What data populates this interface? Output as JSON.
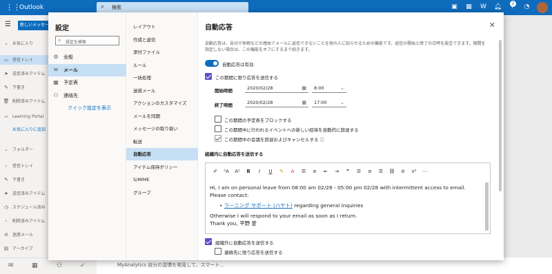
{
  "app": {
    "brand": "Outlook",
    "search_placeholder": "検索",
    "badge_count": "2"
  },
  "leftpane": {
    "new_message": "新しいメッセージ",
    "items": [
      {
        "label": "お気に入り"
      },
      {
        "label": "受信トレイ"
      },
      {
        "label": "送信済みアイテム"
      },
      {
        "label": "下書き"
      },
      {
        "label": "削除済みアイテム"
      },
      {
        "label": "Learning Portal"
      },
      {
        "label": "お気に入りに追加"
      },
      {
        "label": "フォルダー"
      },
      {
        "label": "受信トレイ"
      },
      {
        "label": "下書き"
      },
      {
        "label": "送信済みアイテム"
      },
      {
        "label": "スケジュール済み"
      },
      {
        "label": "削除済みアイテム"
      },
      {
        "label": "迷惑メール"
      },
      {
        "label": "アーカイブ"
      }
    ]
  },
  "maillist": {
    "preview": "MyAnalytics 自分の習慣を発見して、スマート..."
  },
  "settings": {
    "title": "設定",
    "search_placeholder": "設定を検索",
    "categories": [
      {
        "label": "全般",
        "icon": "gear-icon"
      },
      {
        "label": "メール",
        "icon": "mail-icon"
      },
      {
        "label": "予定表",
        "icon": "calendar-icon"
      },
      {
        "label": "連絡先",
        "icon": "people-icon"
      }
    ],
    "quick_settings_link": "クイック設定を表示",
    "mail_sections": [
      "レイアウト",
      "作成と返信",
      "添付ファイル",
      "ルール",
      "一括処理",
      "迷惑メール",
      "アクションのカスタマイズ",
      "メールを同期",
      "メッセージの取り扱い",
      "転送",
      "自動応答",
      "アイテム保持ポリシー",
      "S/MIME",
      "グループ"
    ],
    "selected_section": "自動応答"
  },
  "autoreply": {
    "title": "自動応答",
    "description": "自動応答は、自分が休暇などの理由でメールに返信できないことを他の人に知らせるための機能です。返信の開始と終了の日時を設定できます。期間を指定しない場合は、この機能をオフにするまで続きます。",
    "toggle_label": "自動応答は有効",
    "toggle_on": true,
    "period_checkbox": "この期間に限り応答を送信する",
    "start_label": "開始時間",
    "start_date": "2020/02/28",
    "start_time": "8:00",
    "end_label": "終了時間",
    "end_date": "2020/02/28",
    "end_time": "17:00",
    "opt_block_calendar": "この期間の予定表をブロックする",
    "opt_decline_invites": "この期間中に行われるイベントへの新しい招待を自動的に辞退する",
    "opt_cancel_meetings": "この期間中の会議を辞退およびキャンセルする",
    "internal_heading": "組織内に自動応答を送信する",
    "message_line1": "Hi, I am on personal leave from 08:00 am 02/28 - 05:00 pm 02/28 with intermittent access to email. Please contact:",
    "message_link": "ラーニング サポート (ハヤト)",
    "message_link_suffix": " regarding general inquiries",
    "message_line2": "Otherwise I will respond to your email as soon as I return.",
    "message_line3": "Thank you, 平野 愛",
    "external_checkbox": "組織外に自動応答を送信する",
    "contacts_only_checkbox": "連絡先に限り応答を送信する"
  },
  "colors": {
    "accent": "#0f6cbd",
    "selected": "#c7dff5",
    "checkbox": "#5b4fc8"
  }
}
